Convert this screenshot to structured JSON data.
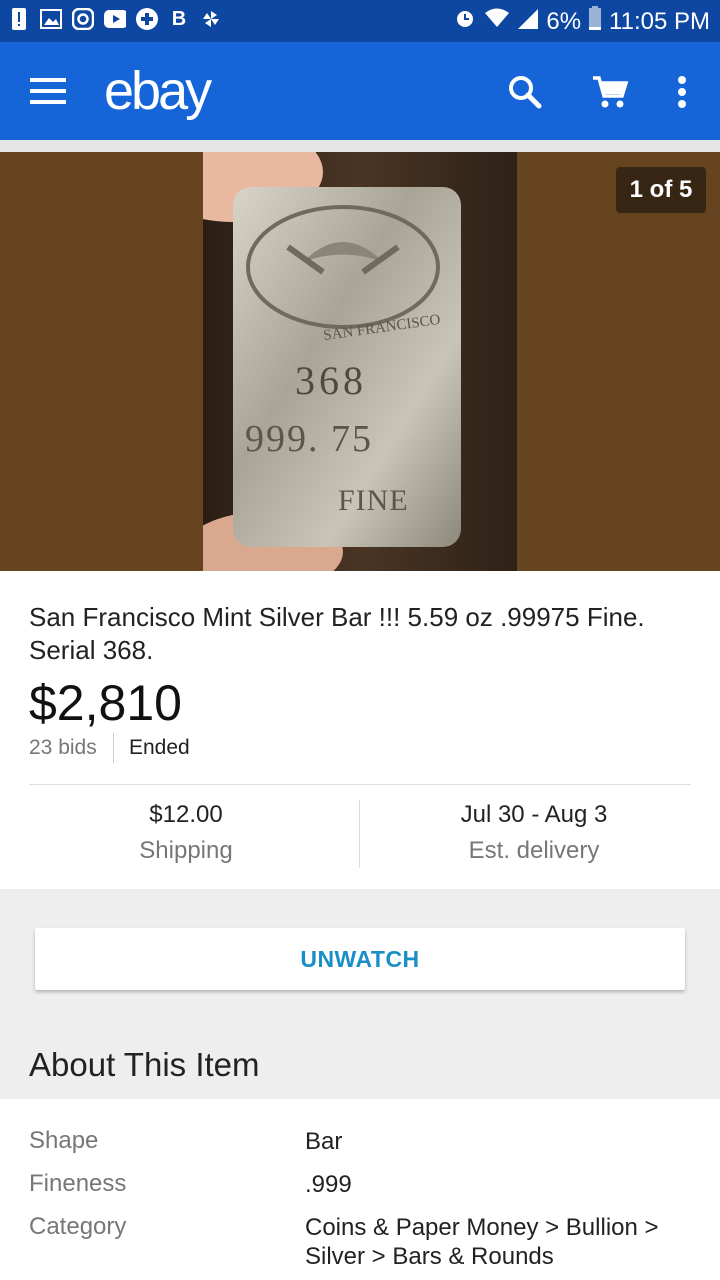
{
  "status_bar": {
    "left_icons": [
      "alert-icon",
      "gallery-icon",
      "instagram-icon",
      "youtube-icon",
      "plus-app-icon",
      "b-app-icon",
      "pinwheel-icon"
    ],
    "battery": "6%",
    "time": "11:05 PM"
  },
  "app_bar": {
    "logo": "ebay",
    "brand_color": "#1565d8"
  },
  "gallery": {
    "counter": "1 of 5",
    "stamp_number": "368",
    "stamp_fineness": "999. 75",
    "stamp_word": "FINE",
    "stamp_arc": "SAN FRANCISCO"
  },
  "listing": {
    "title": "San Francisco Mint Silver Bar  !!!  5.59 oz .99975 Fine. Serial 368.",
    "price": "$2,810",
    "bids": "23 bids",
    "status": "Ended",
    "shipping_value": "$12.00",
    "shipping_label": "Shipping",
    "delivery_value": "Jul 30 - Aug 3",
    "delivery_label": "Est. delivery"
  },
  "actions": {
    "unwatch_label": "UNWATCH"
  },
  "about": {
    "title": "About This Item",
    "specs": [
      {
        "key": "Shape",
        "value": "Bar"
      },
      {
        "key": "Fineness",
        "value": ".999"
      },
      {
        "key": "Category",
        "value": "Coins & Paper Money > Bullion > Silver > Bars & Rounds"
      }
    ]
  }
}
